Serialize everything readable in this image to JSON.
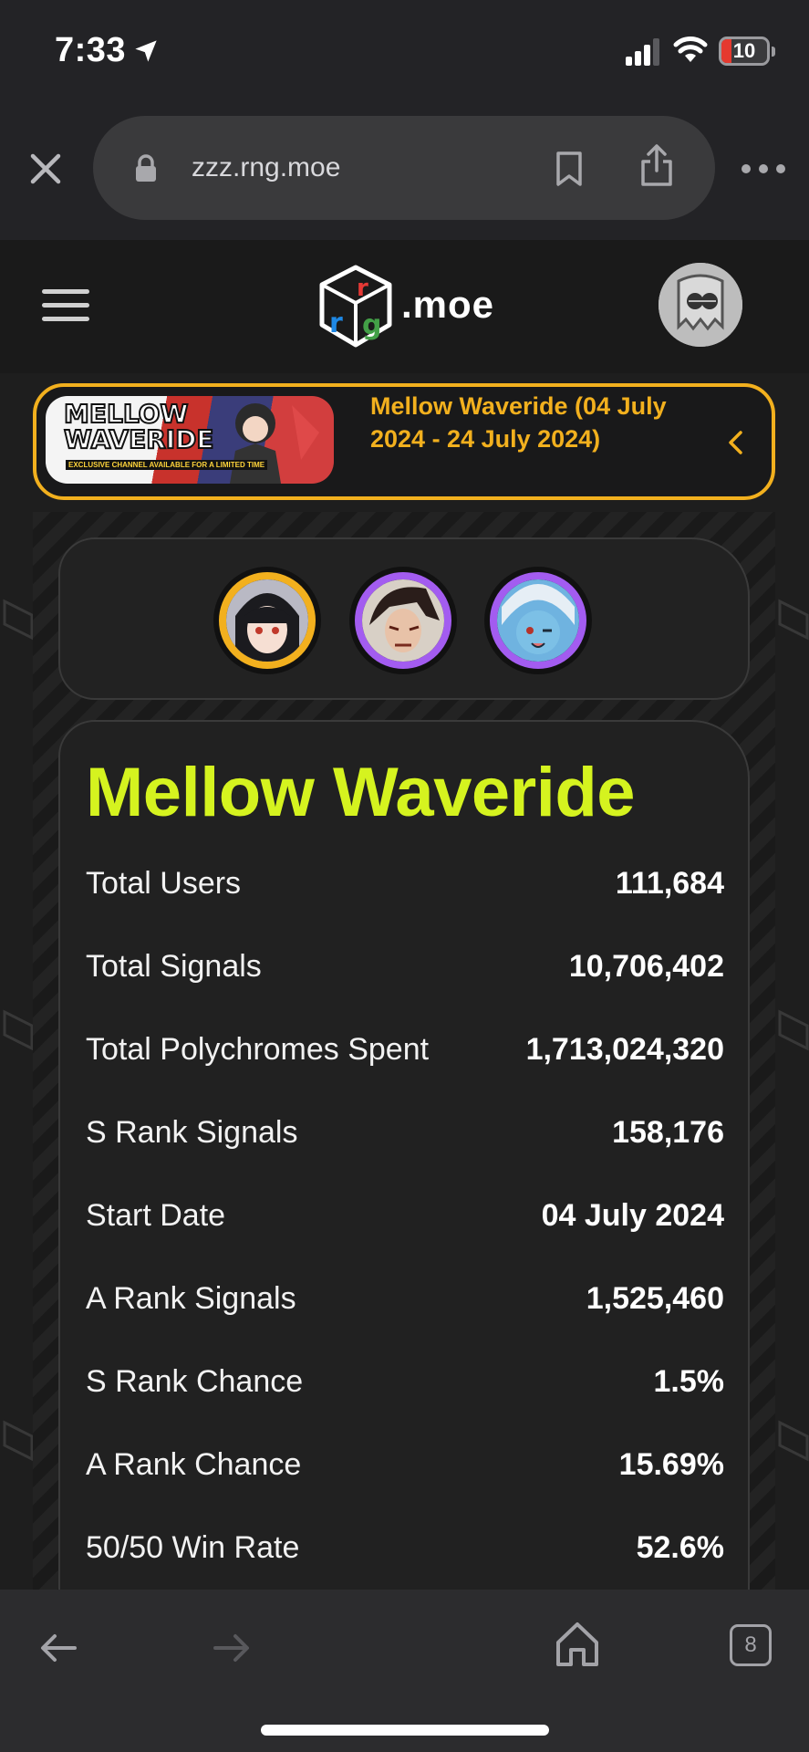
{
  "status_bar": {
    "time": "7:33",
    "battery": "10"
  },
  "browser": {
    "url": "zzz.rng.moe",
    "tab_count": "8"
  },
  "site": {
    "logo_text": ".moe"
  },
  "banner": {
    "image_title_line1": "MELLOW",
    "image_title_line2": "WAVERIDE",
    "image_sub": "EXCLUSIVE CHANNEL AVAILABLE FOR A LIMITED TIME",
    "title": "Mellow Waveride (04 July 2024 - 24 July 2024)"
  },
  "characters": [
    {
      "name": "S-rank featured agent",
      "ring_color": "#f2b01e"
    },
    {
      "name": "A-rank agent 1",
      "ring_color": "#a35cf0"
    },
    {
      "name": "A-rank agent 2",
      "ring_color": "#a35cf0"
    }
  ],
  "stats": {
    "title": "Mellow Waveride",
    "rows": [
      {
        "label": "Total Users",
        "value": "111,684"
      },
      {
        "label": "Total Signals",
        "value": "10,706,402"
      },
      {
        "label": "Total Polychromes Spent",
        "value": "1,713,024,320"
      },
      {
        "label": "S Rank Signals",
        "value": "158,176"
      },
      {
        "label": "Start Date",
        "value": "04 July 2024"
      },
      {
        "label": "A Rank Signals",
        "value": "1,525,460"
      },
      {
        "label": "S Rank Chance",
        "value": "1.5%"
      },
      {
        "label": "A Rank Chance",
        "value": "15.69%"
      },
      {
        "label": "50/50 Win Rate",
        "value": "52.6%"
      }
    ]
  },
  "colors": {
    "accent_yellow": "#f2b01e",
    "title_lime": "#d5f31f",
    "a_rank_purple": "#a35cf0"
  }
}
